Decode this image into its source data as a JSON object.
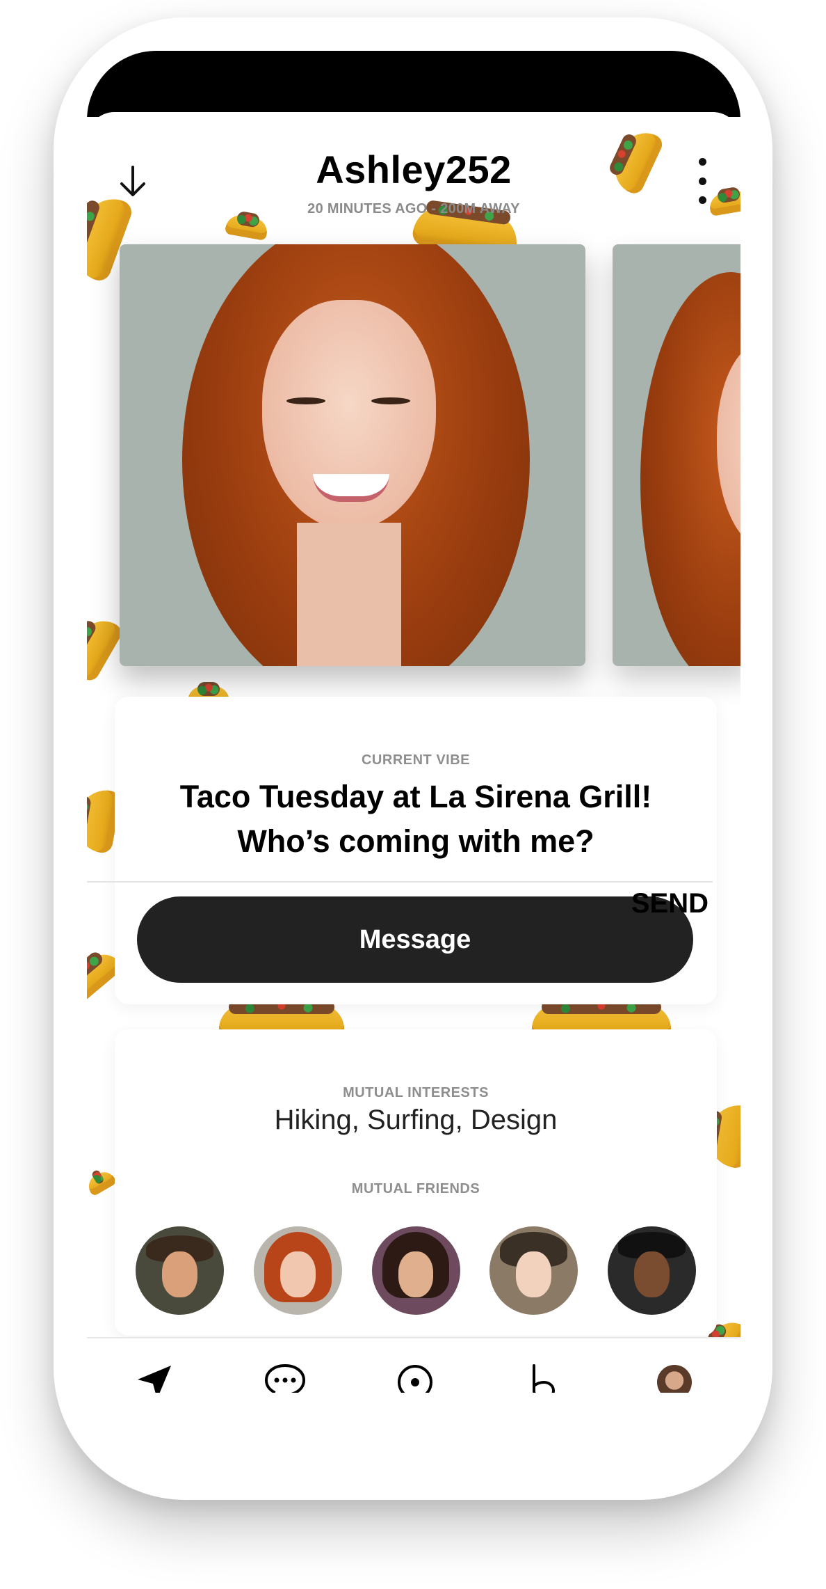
{
  "profile": {
    "username": "Ashley252",
    "meta": "20 MINUTES AGO  -  200M AWAY"
  },
  "vibe": {
    "label": "CURRENT VIBE",
    "text": "Taco Tuesday at La Sirena Grill! Who’s coming with me?"
  },
  "message": {
    "button_label": "Message",
    "send_label": "SEND"
  },
  "interests": {
    "label": "MUTUAL INTERESTS",
    "text": "Hiking, Surfing, Design"
  },
  "friends": {
    "label": "MUTUAL FRIENDS",
    "count": 5
  },
  "nav": {
    "items": [
      "navigate-icon",
      "chat-icon",
      "discover-icon",
      "b-icon",
      "profile-avatar"
    ],
    "notification_dots": [
      false,
      true,
      false,
      true,
      true
    ]
  },
  "colors": {
    "accent_dark": "#222222",
    "notification": "#e23b3b",
    "muted_text": "#8e8e8e",
    "taco_yellow": "#f4c23a"
  }
}
